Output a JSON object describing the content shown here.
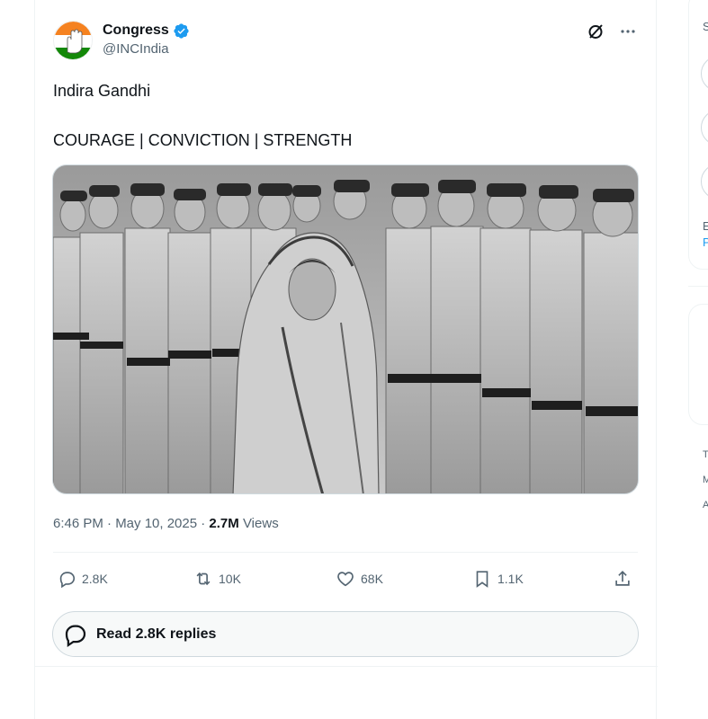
{
  "tweet": {
    "display_name": "Congress",
    "handle": "@INCIndia",
    "text_line1": "Indira Gandhi",
    "text_line2": "COURAGE | CONVICTION | STRENGTH",
    "time": "6:46 PM · May 10, 2025 · ",
    "views_count": "2.7M",
    "views_label": " Views",
    "media_icon": "black-and-white-photo"
  },
  "actions": {
    "replies": "2.8K",
    "reposts": "10K",
    "likes": "68K",
    "bookmarks": "1.1K"
  },
  "read_replies": {
    "label": "Read 2.8K replies"
  },
  "sidebar": {
    "line_s": "S",
    "line_e": "E",
    "line_p": "P",
    "line_t": "T",
    "line_m": "M",
    "line_a": "A"
  },
  "colors": {
    "verified": "#1d9bf0",
    "secondary_text": "#536471",
    "border": "#cfd9de"
  }
}
